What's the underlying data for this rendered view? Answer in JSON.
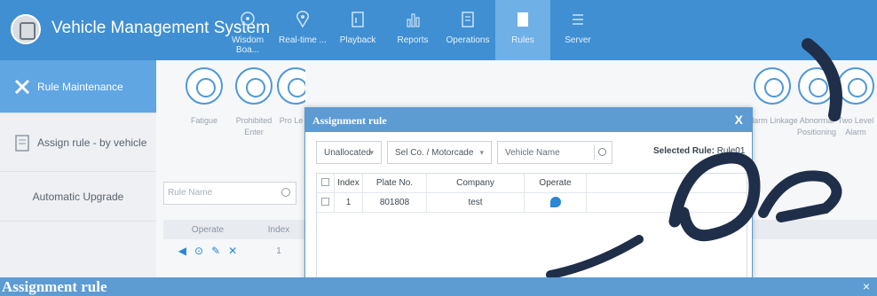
{
  "app": {
    "title": "Vehicle Management System"
  },
  "nav": [
    {
      "label": "Wisdom Boa...",
      "icon": "dashboard-icon",
      "active": false
    },
    {
      "label": "Real-time ...",
      "icon": "location-pin-icon",
      "active": false
    },
    {
      "label": "Playback",
      "icon": "playback-icon",
      "active": false
    },
    {
      "label": "Reports",
      "icon": "bar-chart-icon",
      "active": false
    },
    {
      "label": "Operations",
      "icon": "operations-icon",
      "active": false
    },
    {
      "label": "Rules",
      "icon": "rules-icon",
      "active": true
    },
    {
      "label": "Server",
      "icon": "server-icon",
      "active": false
    }
  ],
  "sidebar": {
    "items": [
      {
        "label": "Rule Maintenance",
        "icon": "wrench-icon",
        "active": true
      },
      {
        "label": "Assign rule - by vehicle",
        "icon": "document-icon",
        "active": false
      },
      {
        "label": "Automatic Upgrade",
        "active": false
      }
    ]
  },
  "rule_icons": {
    "left": [
      {
        "label": "Fatigue"
      },
      {
        "label": "Prohibited Enter"
      },
      {
        "label": "Pro Le"
      }
    ],
    "right": [
      {
        "label": "Alarm Linkage"
      },
      {
        "label": "Abnormal Positioning"
      },
      {
        "label": "Two Level Alarm"
      }
    ]
  },
  "search": {
    "placeholder": "Rule Name"
  },
  "grid": {
    "headers": {
      "operate": "Operate",
      "index": "Index"
    },
    "row_index": "1"
  },
  "modal": {
    "title": "Assignment rule",
    "close": "X",
    "filter_unallocated": "Unallocated",
    "filter_company": "Sel Co. / Motorcade",
    "vehicle_placeholder": "Vehicle Name",
    "selected_rule_label": "Selected Rule:",
    "selected_rule_value": "Rule01",
    "columns": {
      "index": "Index",
      "plate": "Plate No.",
      "company": "Company",
      "operate": "Operate"
    },
    "rows": [
      {
        "index": "1",
        "plate": "801808",
        "company": "test"
      }
    ]
  },
  "bottom_bar": {
    "title": "Assignment rule",
    "close": "×"
  },
  "colors": {
    "header": "#3f8fd2",
    "accent": "#5d9bd3",
    "active_tab": "#6fb0e6"
  }
}
